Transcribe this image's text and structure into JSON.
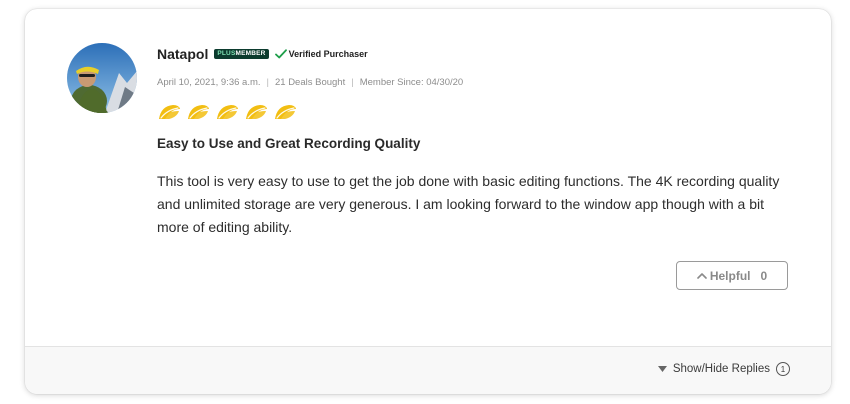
{
  "review": {
    "reviewer_name": "Natapol",
    "badge": {
      "plus": "PLUS",
      "member": "MEMBER"
    },
    "verified_label": "Verified Purchaser",
    "date": "April 10, 2021, 9:36 a.m.",
    "deals_bought": "21 Deals Bought",
    "member_since": "Member Since: 04/30/20",
    "rating": {
      "value": 5,
      "max": 5,
      "icon": "taco-icon",
      "color": "#f2be12"
    },
    "title": "Easy to Use and Great Recording Quality",
    "body": "This tool is very easy to use to get the job done with basic editing functions. The 4K recording quality and unlimited storage are very generous. I am looking forward to the window app though with a bit more of editing ability.",
    "helpful": {
      "label": "Helpful",
      "count": "0"
    }
  },
  "footer": {
    "replies_label": "Show/Hide Replies",
    "replies_count": "1"
  },
  "colors": {
    "badge_bg": "#0c3b2e",
    "verified_check": "#1e9e4a",
    "star": "#f2be12"
  }
}
